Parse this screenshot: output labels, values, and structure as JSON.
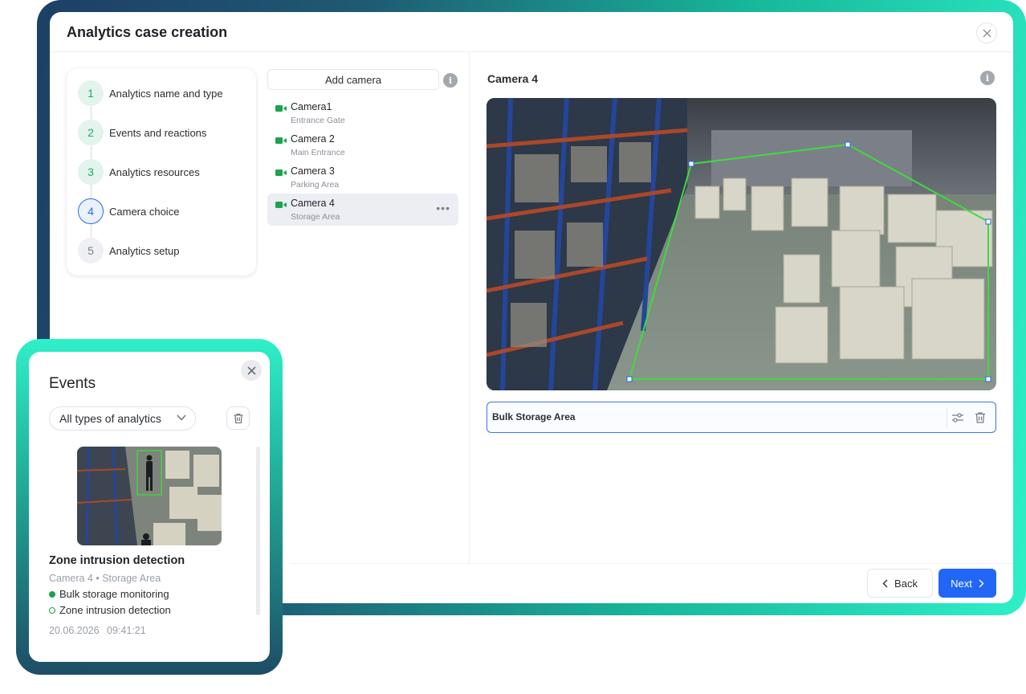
{
  "window": {
    "title": "Analytics case creation"
  },
  "steps": [
    {
      "number": "1",
      "label": "Analytics name and type",
      "state": "done"
    },
    {
      "number": "2",
      "label": "Events and reactions",
      "state": "done"
    },
    {
      "number": "3",
      "label": "Analytics resources",
      "state": "done"
    },
    {
      "number": "4",
      "label": "Camera choice",
      "state": "active"
    },
    {
      "number": "5",
      "label": "Analytics setup",
      "state": "todo"
    }
  ],
  "cameras": {
    "add_label": "Add camera",
    "items": [
      {
        "name": "Camera1",
        "location": "Entrance Gate"
      },
      {
        "name": "Camera 2",
        "location": "Main Entrance"
      },
      {
        "name": "Camera 3",
        "location": "Parking Area"
      },
      {
        "name": "Camera 4",
        "location": "Storage Area",
        "selected": true
      }
    ]
  },
  "view": {
    "title": "Camera 4",
    "zone_name": "Bulk Storage Area"
  },
  "footer": {
    "back_label": "Back",
    "next_label": "Next"
  },
  "events": {
    "title": "Events",
    "filter_value": "All types of analytics",
    "item": {
      "name": "Zone intrusion detection",
      "camera": "Camera 4 • Storage Area",
      "tags": [
        "Bulk storage monitoring",
        "Zone intrusion detection"
      ],
      "date": "20.06.2026",
      "time": "09:41:21"
    }
  },
  "colors": {
    "accent": "#2166f5",
    "success": "#1ba34e",
    "zone": "#3ddc3d"
  }
}
